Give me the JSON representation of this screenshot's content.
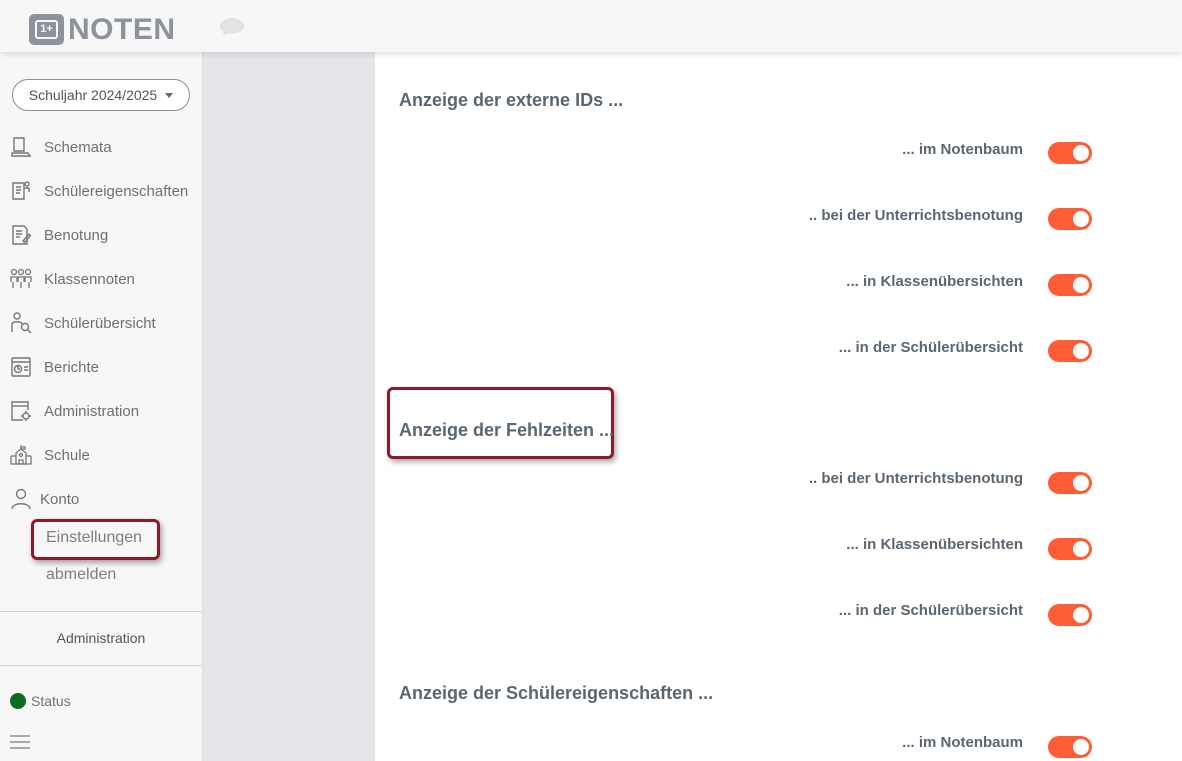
{
  "app": {
    "logo_text": "NOTEN",
    "logo_badge": "1+"
  },
  "sidebar": {
    "year_selector": "Schuljahr 2024/2025",
    "items": [
      {
        "label": "Schemata",
        "icon": "schemata-icon"
      },
      {
        "label": "Schülereigenschaften",
        "icon": "student-properties-icon"
      },
      {
        "label": "Benotung",
        "icon": "grading-icon"
      },
      {
        "label": "Klassennoten",
        "icon": "class-grades-icon"
      },
      {
        "label": "Schülerübersicht",
        "icon": "student-overview-icon"
      },
      {
        "label": "Berichte",
        "icon": "reports-icon"
      },
      {
        "label": "Administration",
        "icon": "administration-icon"
      },
      {
        "label": "Schule",
        "icon": "school-icon"
      },
      {
        "label": "Konto",
        "icon": "account-icon"
      }
    ],
    "sub_items": {
      "settings": "Einstellungen",
      "logout": "abmelden"
    },
    "footer_admin": "Administration",
    "status_label": "Status",
    "status_color": "#0b6b1e"
  },
  "main": {
    "sections": [
      {
        "title": "Anzeige der externe IDs ...",
        "options": [
          {
            "label": "... im Notenbaum",
            "enabled": true
          },
          {
            "label": ".. bei der Unterrichtsbenotung",
            "enabled": true
          },
          {
            "label": "... in Klassenübersichten",
            "enabled": true
          },
          {
            "label": "... in der Schülerübersicht",
            "enabled": true
          }
        ]
      },
      {
        "title": "Anzeige der Fehlzeiten ...",
        "options": [
          {
            "label": ".. bei der Unterrichtsbenotung",
            "enabled": true
          },
          {
            "label": "... in Klassenübersichten",
            "enabled": true
          },
          {
            "label": "... in der Schülerübersicht",
            "enabled": true
          }
        ]
      },
      {
        "title": "Anzeige der Schülereigenschaften ...",
        "options": [
          {
            "label": "... im Notenbaum",
            "enabled": true
          }
        ]
      }
    ]
  },
  "colors": {
    "toggle_on": "#ff5d36",
    "highlight": "#8b1a2b"
  }
}
